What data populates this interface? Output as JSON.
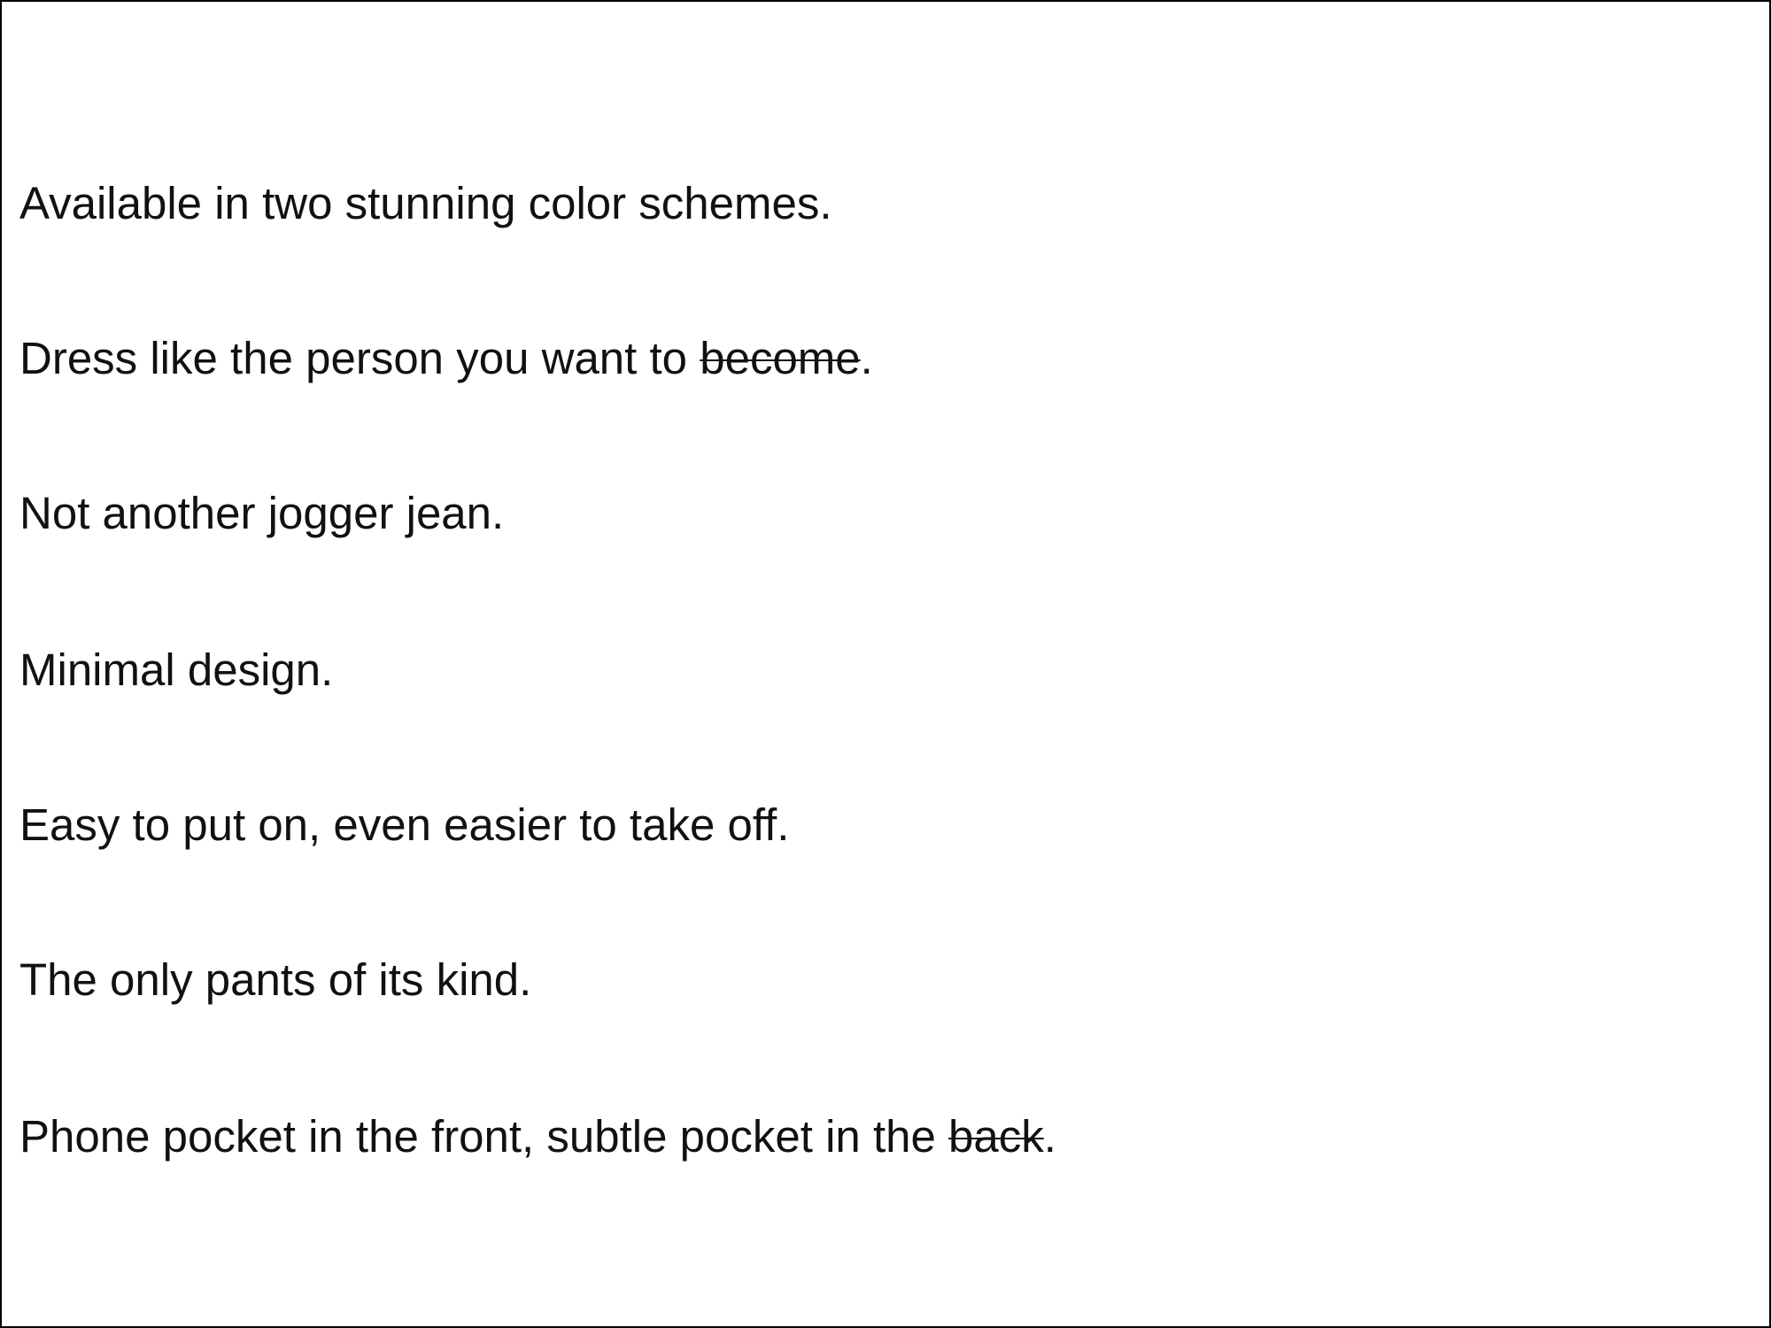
{
  "document": {
    "lines": [
      {
        "text": "Available in two stunning color schemes."
      },
      {
        "text_before": "Dress like the person you want to ",
        "struck": "become",
        "text_after": "."
      },
      {
        "text": "Not another jogger jean."
      },
      {
        "text": "Minimal design."
      },
      {
        "text": "Easy to put on, even easier to take off."
      },
      {
        "text": "The only pants of its kind."
      },
      {
        "text_before": "Phone pocket in the front, subtle pocket in the ",
        "struck": "back",
        "text_after": "."
      }
    ]
  }
}
